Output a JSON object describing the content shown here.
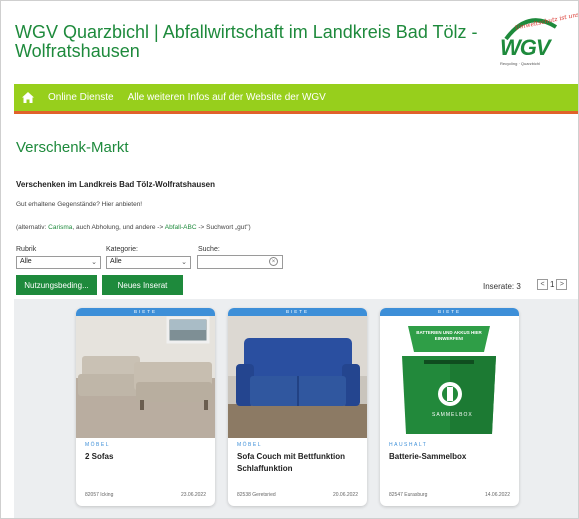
{
  "header": {
    "title": "WGV Quarzbichl | Abfallwirtschaft im Landkreis Bad Tölz - Wolfratshausen"
  },
  "logo": {
    "slogan": "Umweltschutz ist uns wichtig !",
    "word": "WGV",
    "sub": "Recycling · Quarzbichl",
    "icon": "wgv-logo"
  },
  "nav": {
    "home_icon": "home-icon",
    "items": [
      {
        "label": "Online Dienste"
      },
      {
        "label": "Alle weiteren Infos auf der Website der WGV"
      }
    ]
  },
  "page": {
    "title": "Verschenk-Markt",
    "subheading": "Verschenken im Landkreis Bad Tölz-Wolfratshausen",
    "intro": "Gut erhaltene Gegenstände? Hier anbieten!",
    "alt_prefix": "(alternativ:",
    "alt_link1": "Carisma",
    "alt_middle": ", auch Abholung, und andere ->",
    "alt_link2": "Abfall-ABC",
    "alt_suffix": "-> Suchwort „gut\")"
  },
  "filters": {
    "rubric_label": "Rubrik",
    "rubric_value": "Alle",
    "category_label": "Kategorie:",
    "category_value": "Alle",
    "search_label": "Suche:",
    "search_placeholder": ""
  },
  "buttons": {
    "terms": "Nutzungsbeding...",
    "new_ad": "Neues Inserat"
  },
  "listing": {
    "count_text": "Inserate: 3",
    "page": "1",
    "prev": "<",
    "next": ">"
  },
  "cards": [
    {
      "ribbon": "BIETE",
      "category": "MÖBEL",
      "title": "2 Sofas",
      "location": "82057 Icking",
      "date": "23.06.2022"
    },
    {
      "ribbon": "BIETE",
      "category": "MÖBEL",
      "title": "Sofa Couch mit Bettfunktion Schlaffunktion",
      "location": "82538 Geretsried",
      "date": "20.06.2022"
    },
    {
      "ribbon": "BIETE",
      "category": "HAUSHALT",
      "title": "Batterie-Sammelbox",
      "location": "82547 Eurasburg",
      "date": "14.06.2022"
    }
  ],
  "collection_box": {
    "banner": "BATTERIEN UND AKKUS HIER EINWERFEN!",
    "label": "SAMMELBOX"
  },
  "colors": {
    "brand_green": "#1e8a3c",
    "nav_green": "#97cf1c",
    "nav_accent": "#e0622a",
    "ribbon_blue": "#3d8fd8"
  }
}
